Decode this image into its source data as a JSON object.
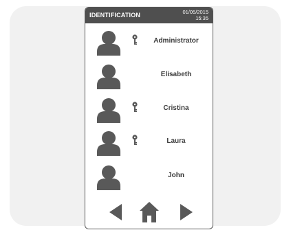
{
  "header": {
    "title": "IDENTIFICATION",
    "date": "01/05/2015",
    "time": "15:35"
  },
  "users": [
    {
      "name": "Administrator",
      "has_key": true
    },
    {
      "name": "Elisabeth",
      "has_key": false
    },
    {
      "name": "Cristina",
      "has_key": true
    },
    {
      "name": "Laura",
      "has_key": true
    },
    {
      "name": "John",
      "has_key": false
    }
  ],
  "nav": {
    "back_icon": "triangle-left-icon",
    "home_icon": "home-icon",
    "forward_icon": "triangle-right-icon"
  },
  "colors": {
    "header_bg": "#4f4f4f",
    "icon_gray": "#595959",
    "text": "#3c3c3c"
  }
}
